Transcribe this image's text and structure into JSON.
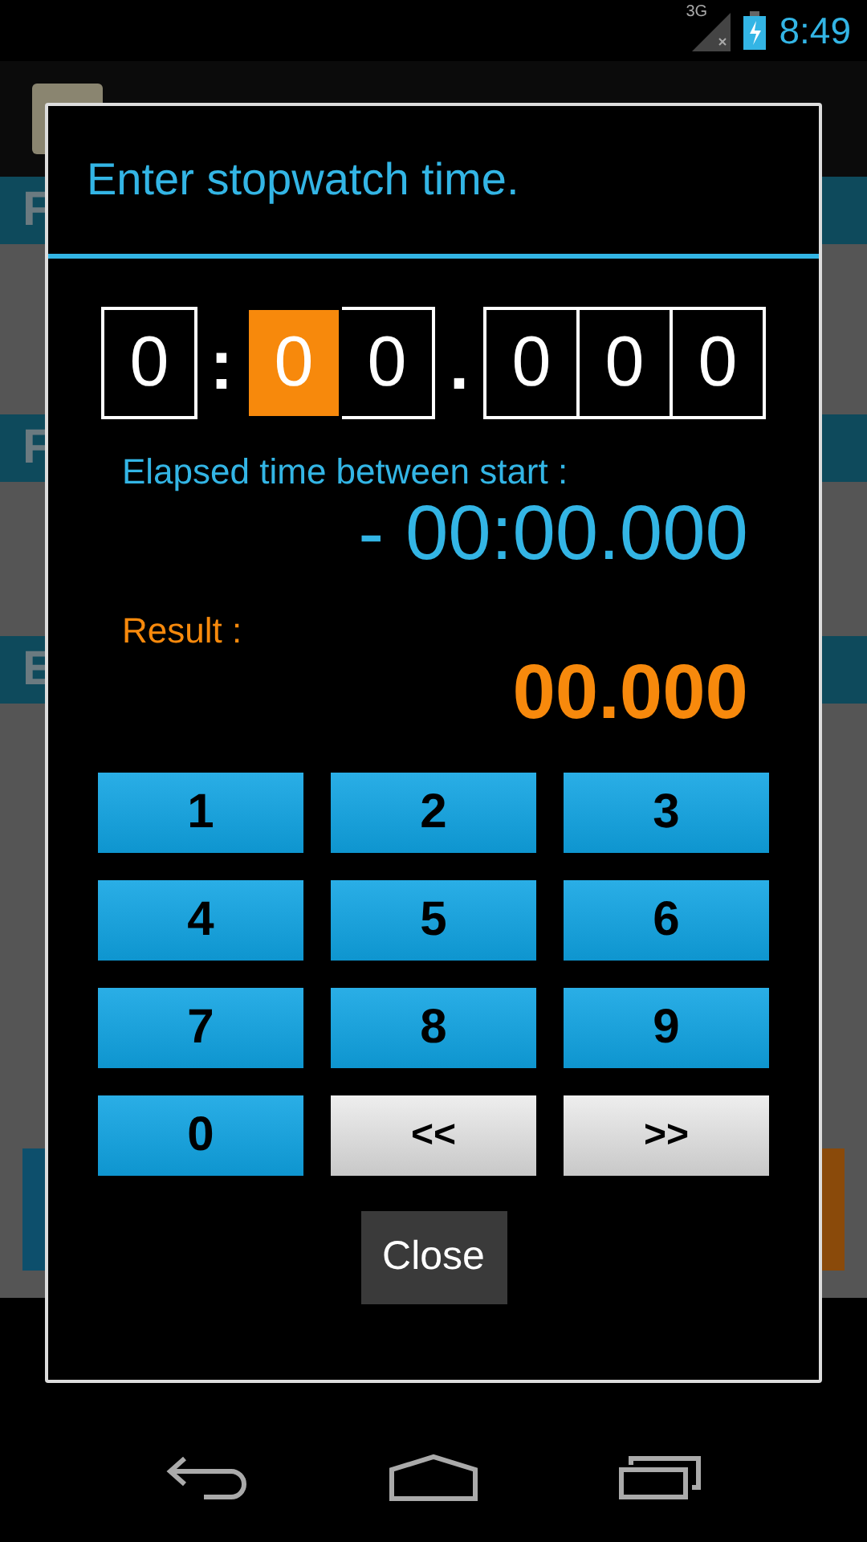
{
  "status_bar": {
    "network": "3G",
    "time": "8:49"
  },
  "background": {
    "sections": [
      {
        "header": "F"
      },
      {
        "header": "F"
      },
      {
        "header": "E"
      }
    ]
  },
  "dialog": {
    "title": "Enter stopwatch time.",
    "digits": [
      {
        "kind": "digit",
        "text": "0",
        "selected": false
      },
      {
        "kind": "separator",
        "text": ":"
      },
      {
        "kind": "digit",
        "text": "0",
        "selected": true
      },
      {
        "kind": "digit",
        "text": "0",
        "selected": false
      },
      {
        "kind": "separator",
        "text": "."
      },
      {
        "kind": "digit",
        "text": "0",
        "selected": false
      },
      {
        "kind": "digit",
        "text": "0",
        "selected": false
      },
      {
        "kind": "digit",
        "text": "0",
        "selected": false
      }
    ],
    "elapsed_label": "Elapsed time between start :",
    "elapsed_value": "- 00:00.000",
    "result_label": "Result :",
    "result_value": "00.000",
    "keys": [
      {
        "kind": "digit",
        "label": "1"
      },
      {
        "kind": "digit",
        "label": "2"
      },
      {
        "kind": "digit",
        "label": "3"
      },
      {
        "kind": "digit",
        "label": "4"
      },
      {
        "kind": "digit",
        "label": "5"
      },
      {
        "kind": "digit",
        "label": "6"
      },
      {
        "kind": "digit",
        "label": "7"
      },
      {
        "kind": "digit",
        "label": "8"
      },
      {
        "kind": "digit",
        "label": "9"
      },
      {
        "kind": "digit",
        "label": "0"
      },
      {
        "kind": "nav",
        "label": "<<"
      },
      {
        "kind": "nav",
        "label": ">>"
      }
    ],
    "close_button": "Close"
  }
}
